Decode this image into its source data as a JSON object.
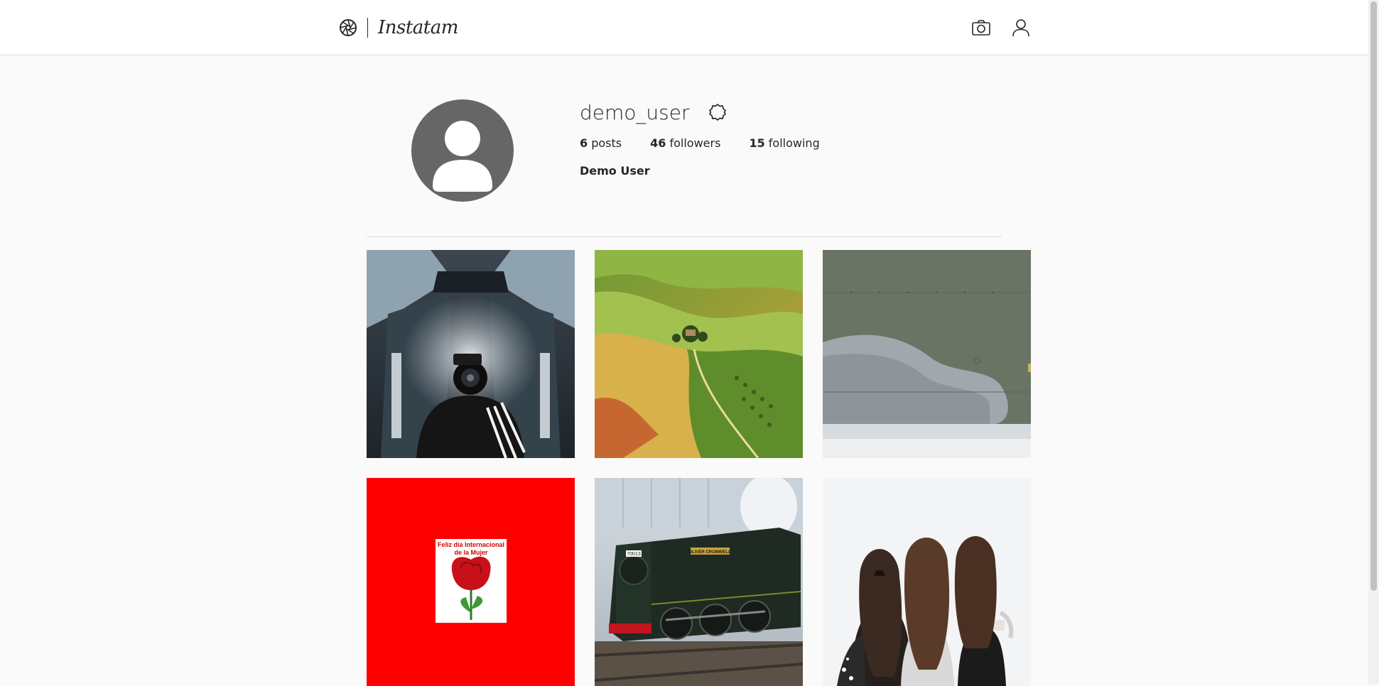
{
  "app": {
    "brand_name": "Instatam",
    "brand_icon": "aperture-icon",
    "nav_icons": [
      "camera-icon",
      "user-icon"
    ]
  },
  "profile": {
    "username": "demo_user",
    "full_name": "Demo User",
    "posts_count": "6",
    "posts_label": "posts",
    "followers_count": "46",
    "followers_label": "followers",
    "following_count": "15",
    "following_label": "following",
    "avatar_color": "#666666"
  },
  "posts": [
    {
      "index": 1,
      "subject": "photographer with camera in smoke on escalator"
    },
    {
      "index": 2,
      "subject": "aerial view of green rolling hills"
    },
    {
      "index": 3,
      "subject": "grey aircraft fuselage panel"
    },
    {
      "index": 4,
      "subject": "red rose card",
      "caption": "Feliz día Internacional de la Mujer"
    },
    {
      "index": 5,
      "subject": "steam locomotive",
      "plate": "70013",
      "nameplate": "OLIVER CROMWELL"
    },
    {
      "index": 6,
      "subject": "three women with long hair from behind"
    }
  ]
}
